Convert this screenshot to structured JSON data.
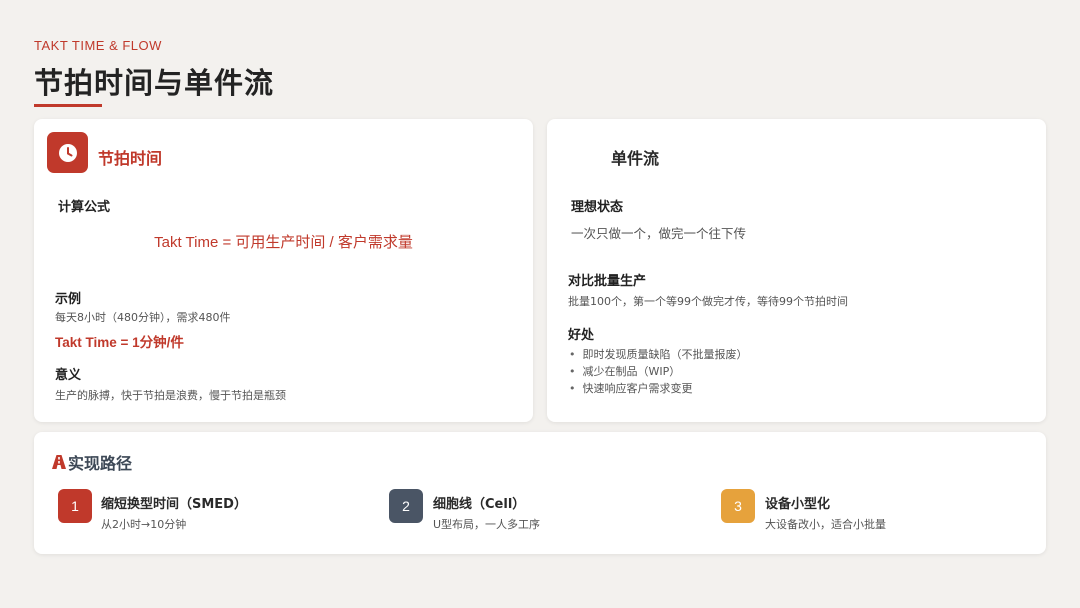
{
  "header": {
    "eyebrow": "TAKT TIME & FLOW",
    "title": "节拍时间与单件流"
  },
  "colors": {
    "accent": "#c0392b",
    "slate": "#4a5565",
    "amber": "#e6a23c",
    "background": "#f3f1ee"
  },
  "left_card": {
    "icon": "clock-icon",
    "title": "节拍时间",
    "formula_label": "计算公式",
    "formula": "Takt Time = 可用生产时间 / 客户需求量",
    "example_label": "示例",
    "example_text": "每天8小时（480分钟），需求480件",
    "example_result": "Takt Time = 1分钟/件",
    "meaning_label": "意义",
    "meaning_text": "生产的脉搏，快于节拍是浪费，慢于节拍是瓶颈"
  },
  "right_card": {
    "title": "单件流",
    "ideal_label": "理想状态",
    "ideal_text": "一次只做一个，做完一个往下传",
    "compare_label": "对比批量生产",
    "compare_text": "批量100个，第一个等99个做完才传，等待99个节拍时间",
    "benefits_label": "好处",
    "benefits": [
      "即时发现质量缺陷（不批量报废）",
      "减少在制品（WIP）",
      "快速响应客户需求变更"
    ]
  },
  "bottom_card": {
    "icon": "road-icon",
    "title": "实现路径",
    "steps": [
      {
        "num": "1",
        "title": "缩短换型时间（SMED）",
        "desc": "从2小时→10分钟"
      },
      {
        "num": "2",
        "title": "细胞线（Cell）",
        "desc": "U型布局，一人多工序"
      },
      {
        "num": "3",
        "title": "设备小型化",
        "desc": "大设备改小，适合小批量"
      }
    ]
  }
}
